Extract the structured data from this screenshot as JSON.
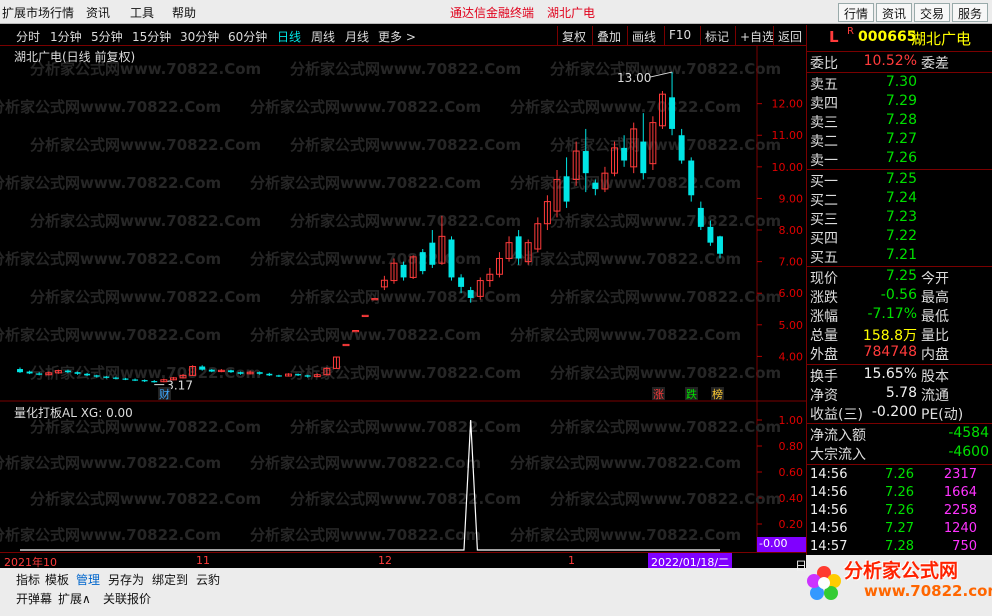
{
  "menubar": {
    "items": [
      "扩展市场行情",
      "资讯",
      "工具",
      "帮助"
    ],
    "app_title": "通达信金融终端",
    "stock_title": "湖北广电",
    "right_buttons": [
      "行情",
      "资讯",
      "交易",
      "服务"
    ]
  },
  "tabs": {
    "periods": [
      "分时",
      "1分钟",
      "5分钟",
      "15分钟",
      "30分钟",
      "60分钟",
      "日线",
      "周线",
      "月线",
      "更多 >"
    ],
    "active": "日线",
    "tools": [
      "复权",
      "叠加",
      "画线",
      "F10",
      "标记",
      "+自选",
      "返回"
    ]
  },
  "chart": {
    "caption": "湖北广电(日线 前复权)",
    "high_label": "13.00",
    "low_label": "3.17",
    "badges": {
      "cai": "财",
      "zhang": "涨",
      "die": "跌",
      "bang": "榜"
    },
    "watermark": "分析家公式网www.70822.Com"
  },
  "indicator": {
    "caption": "量化打板AL  XG: 0.00",
    "current_value": "-0.00"
  },
  "xaxis": {
    "labels": [
      "2021年10",
      "11",
      "12",
      "1"
    ],
    "cursor_date": "2022/01/18/二"
  },
  "bottom": {
    "row1": [
      "指标",
      "模板",
      "管理",
      "另存为",
      "绑定到",
      "云豹"
    ],
    "row1_active": "管理",
    "row2": [
      "开弹幕",
      "扩展∧",
      "关联报价"
    ]
  },
  "quote": {
    "L": "L",
    "R": "R",
    "code": "000665",
    "name": "湖北广电",
    "weibi_label": "委比",
    "weibi_value": "10.52%",
    "weicha_label": "委差",
    "asks": [
      {
        "label": "卖五",
        "price": "7.30"
      },
      {
        "label": "卖四",
        "price": "7.29"
      },
      {
        "label": "卖三",
        "price": "7.28"
      },
      {
        "label": "卖二",
        "price": "7.27"
      },
      {
        "label": "卖一",
        "price": "7.26"
      }
    ],
    "bids": [
      {
        "label": "买一",
        "price": "7.25"
      },
      {
        "label": "买二",
        "price": "7.24"
      },
      {
        "label": "买三",
        "price": "7.23"
      },
      {
        "label": "买四",
        "price": "7.22"
      },
      {
        "label": "买五",
        "price": "7.21"
      }
    ],
    "stats": [
      {
        "l1": "现价",
        "v1": "7.25",
        "c1": "green",
        "l2": "今开"
      },
      {
        "l1": "涨跌",
        "v1": "-0.56",
        "c1": "green",
        "l2": "最高"
      },
      {
        "l1": "涨幅",
        "v1": "-7.17%",
        "c1": "green",
        "l2": "最低"
      },
      {
        "l1": "总量",
        "v1": "158.8万",
        "c1": "yellow",
        "l2": "量比"
      },
      {
        "l1": "外盘",
        "v1": "784748",
        "c1": "red",
        "l2": "内盘"
      }
    ],
    "stats2": [
      {
        "l1": "换手",
        "v1": "15.65%",
        "c1": "white",
        "l2": "股本"
      },
      {
        "l1": "净资",
        "v1": "5.78",
        "c1": "white",
        "l2": "流通"
      },
      {
        "l1": "收益(三)",
        "v1": "-0.200",
        "c1": "white",
        "l2": "PE(动)"
      }
    ],
    "flows": [
      {
        "label": "净流入额",
        "value": "-4584"
      },
      {
        "label": "大宗流入",
        "value": "-4600"
      }
    ],
    "ticks": [
      {
        "time": "14:56",
        "price": "7.26",
        "vol": "2317"
      },
      {
        "time": "14:56",
        "price": "7.26",
        "vol": "1664"
      },
      {
        "time": "14:56",
        "price": "7.26",
        "vol": "2258"
      },
      {
        "time": "14:56",
        "price": "7.27",
        "vol": "1240"
      },
      {
        "time": "14:57",
        "price": "7.28",
        "vol": "750"
      }
    ],
    "tick_footer": "日"
  },
  "logo": {
    "text": "分析家公式网",
    "url": "www.70822.com"
  },
  "chart_data": {
    "type": "candlestick",
    "title": "湖北广电(日线 前复权)",
    "y_ticks": [
      4.0,
      5.0,
      6.0,
      7.0,
      8.0,
      9.0,
      10.0,
      11.0,
      12.0
    ],
    "ylim": [
      3.0,
      13.5
    ],
    "candles": [
      {
        "o": 3.6,
        "c": 3.5,
        "h": 3.65,
        "l": 3.48
      },
      {
        "o": 3.52,
        "c": 3.46,
        "h": 3.55,
        "l": 3.44
      },
      {
        "o": 3.46,
        "c": 3.42,
        "h": 3.5,
        "l": 3.4
      },
      {
        "o": 3.42,
        "c": 3.48,
        "h": 3.52,
        "l": 3.4
      },
      {
        "o": 3.48,
        "c": 3.55,
        "h": 3.58,
        "l": 3.45
      },
      {
        "o": 3.55,
        "c": 3.5,
        "h": 3.58,
        "l": 3.47
      },
      {
        "o": 3.5,
        "c": 3.45,
        "h": 3.52,
        "l": 3.42
      },
      {
        "o": 3.45,
        "c": 3.4,
        "h": 3.48,
        "l": 3.38
      },
      {
        "o": 3.4,
        "c": 3.36,
        "h": 3.42,
        "l": 3.33
      },
      {
        "o": 3.36,
        "c": 3.33,
        "h": 3.38,
        "l": 3.3
      },
      {
        "o": 3.33,
        "c": 3.3,
        "h": 3.36,
        "l": 3.28
      },
      {
        "o": 3.3,
        "c": 3.27,
        "h": 3.32,
        "l": 3.25
      },
      {
        "o": 3.27,
        "c": 3.25,
        "h": 3.3,
        "l": 3.22
      },
      {
        "o": 3.25,
        "c": 3.22,
        "h": 3.27,
        "l": 3.19
      },
      {
        "o": 3.22,
        "c": 3.2,
        "h": 3.25,
        "l": 3.17
      },
      {
        "o": 3.2,
        "c": 3.26,
        "h": 3.3,
        "l": 3.18
      },
      {
        "o": 3.26,
        "c": 3.32,
        "h": 3.35,
        "l": 3.24
      },
      {
        "o": 3.32,
        "c": 3.4,
        "h": 3.44,
        "l": 3.3
      },
      {
        "o": 3.4,
        "c": 3.68,
        "h": 3.72,
        "l": 3.38
      },
      {
        "o": 3.68,
        "c": 3.58,
        "h": 3.72,
        "l": 3.55
      },
      {
        "o": 3.58,
        "c": 3.52,
        "h": 3.6,
        "l": 3.5
      },
      {
        "o": 3.52,
        "c": 3.56,
        "h": 3.6,
        "l": 3.5
      },
      {
        "o": 3.56,
        "c": 3.5,
        "h": 3.58,
        "l": 3.48
      },
      {
        "o": 3.5,
        "c": 3.45,
        "h": 3.52,
        "l": 3.42
      },
      {
        "o": 3.45,
        "c": 3.5,
        "h": 3.55,
        "l": 3.43
      },
      {
        "o": 3.5,
        "c": 3.45,
        "h": 3.52,
        "l": 3.42
      },
      {
        "o": 3.45,
        "c": 3.4,
        "h": 3.48,
        "l": 3.38
      },
      {
        "o": 3.4,
        "c": 3.38,
        "h": 3.42,
        "l": 3.35
      },
      {
        "o": 3.38,
        "c": 3.44,
        "h": 3.47,
        "l": 3.36
      },
      {
        "o": 3.44,
        "c": 3.4,
        "h": 3.46,
        "l": 3.38
      },
      {
        "o": 3.4,
        "c": 3.36,
        "h": 3.42,
        "l": 3.33
      },
      {
        "o": 3.36,
        "c": 3.42,
        "h": 3.46,
        "l": 3.34
      },
      {
        "o": 3.42,
        "c": 3.62,
        "h": 3.66,
        "l": 3.4
      },
      {
        "o": 3.62,
        "c": 3.98,
        "h": 3.98,
        "l": 3.62
      },
      {
        "o": 4.38,
        "c": 4.38,
        "h": 4.38,
        "l": 4.38
      },
      {
        "o": 4.82,
        "c": 4.82,
        "h": 4.82,
        "l": 4.82
      },
      {
        "o": 5.3,
        "c": 5.3,
        "h": 5.3,
        "l": 5.3
      },
      {
        "o": 5.83,
        "c": 5.83,
        "h": 5.83,
        "l": 5.83
      },
      {
        "o": 6.2,
        "c": 6.41,
        "h": 6.55,
        "l": 6.1
      },
      {
        "o": 6.4,
        "c": 6.95,
        "h": 7.1,
        "l": 6.3
      },
      {
        "o": 6.9,
        "c": 6.5,
        "h": 7.0,
        "l": 6.4
      },
      {
        "o": 6.5,
        "c": 7.15,
        "h": 7.2,
        "l": 6.45
      },
      {
        "o": 7.3,
        "c": 6.7,
        "h": 7.4,
        "l": 6.6
      },
      {
        "o": 7.6,
        "c": 6.9,
        "h": 8.0,
        "l": 6.8
      },
      {
        "o": 6.95,
        "c": 7.8,
        "h": 8.45,
        "l": 6.9
      },
      {
        "o": 7.7,
        "c": 6.5,
        "h": 7.8,
        "l": 6.4
      },
      {
        "o": 6.5,
        "c": 6.2,
        "h": 6.6,
        "l": 6.0
      },
      {
        "o": 6.1,
        "c": 5.85,
        "h": 6.2,
        "l": 5.7
      },
      {
        "o": 5.9,
        "c": 6.4,
        "h": 6.5,
        "l": 5.8
      },
      {
        "o": 6.4,
        "c": 6.6,
        "h": 6.8,
        "l": 6.2
      },
      {
        "o": 6.6,
        "c": 7.1,
        "h": 7.3,
        "l": 6.5
      },
      {
        "o": 7.1,
        "c": 7.6,
        "h": 7.8,
        "l": 7.0
      },
      {
        "o": 7.8,
        "c": 7.1,
        "h": 8.0,
        "l": 6.9
      },
      {
        "o": 7.0,
        "c": 7.6,
        "h": 7.7,
        "l": 6.9
      },
      {
        "o": 7.4,
        "c": 8.2,
        "h": 8.4,
        "l": 7.3
      },
      {
        "o": 8.2,
        "c": 8.9,
        "h": 9.1,
        "l": 8.0
      },
      {
        "o": 8.6,
        "c": 9.6,
        "h": 9.9,
        "l": 8.4
      },
      {
        "o": 9.7,
        "c": 8.9,
        "h": 10.3,
        "l": 8.7
      },
      {
        "o": 9.6,
        "c": 10.5,
        "h": 10.8,
        "l": 9.4
      },
      {
        "o": 10.5,
        "c": 9.8,
        "h": 11.2,
        "l": 9.2
      },
      {
        "o": 9.5,
        "c": 9.3,
        "h": 9.6,
        "l": 9.1
      },
      {
        "o": 9.3,
        "c": 9.8,
        "h": 10.0,
        "l": 9.2
      },
      {
        "o": 9.8,
        "c": 10.6,
        "h": 10.8,
        "l": 9.7
      },
      {
        "o": 10.6,
        "c": 10.2,
        "h": 11.0,
        "l": 10.0
      },
      {
        "o": 10.0,
        "c": 11.2,
        "h": 11.4,
        "l": 9.8
      },
      {
        "o": 10.8,
        "c": 9.8,
        "h": 11.7,
        "l": 9.6
      },
      {
        "o": 10.1,
        "c": 11.4,
        "h": 11.6,
        "l": 9.9
      },
      {
        "o": 11.3,
        "c": 12.3,
        "h": 12.4,
        "l": 11.2
      },
      {
        "o": 12.2,
        "c": 11.2,
        "h": 13.0,
        "l": 11.0
      },
      {
        "o": 11.0,
        "c": 10.2,
        "h": 11.2,
        "l": 10.1
      },
      {
        "o": 10.2,
        "c": 9.1,
        "h": 10.3,
        "l": 8.9
      },
      {
        "o": 8.7,
        "c": 8.1,
        "h": 8.9,
        "l": 8.0
      },
      {
        "o": 8.1,
        "c": 7.6,
        "h": 8.3,
        "l": 7.5
      },
      {
        "o": 7.8,
        "c": 7.25,
        "h": 7.82,
        "l": 7.1
      }
    ],
    "indicator": {
      "name": "量化打板AL",
      "signal_index": 47,
      "signal_value": 1.0,
      "y_ticks": [
        0.0,
        0.2,
        0.4,
        0.6,
        0.8,
        1.0
      ]
    }
  }
}
